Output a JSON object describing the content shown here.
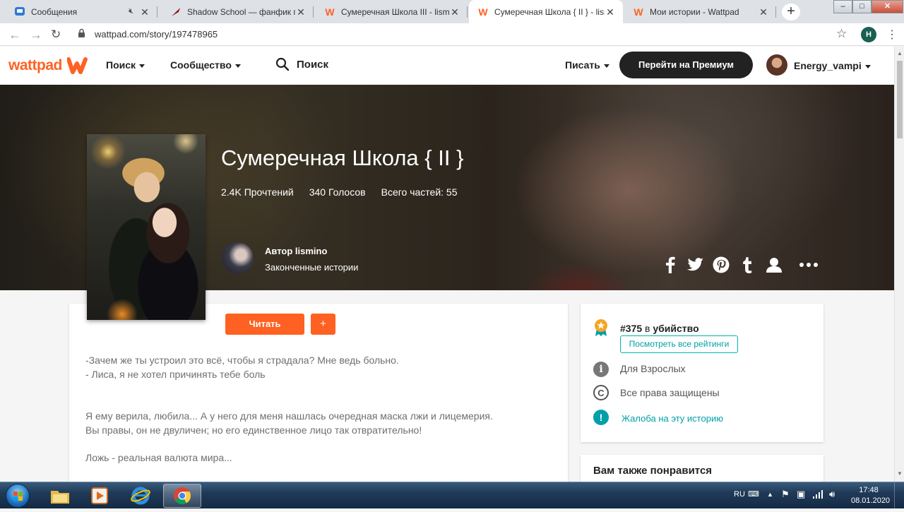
{
  "browser": {
    "tabs": [
      {
        "title": "Сообщения",
        "muted": true
      },
      {
        "title": "Shadow School — фанфик по ф"
      },
      {
        "title": "Сумеречная Школа III - lisminc"
      },
      {
        "title": "Сумеречная Школа { II } - lismi",
        "active": true
      },
      {
        "title": "Мои истории - Wattpad"
      }
    ],
    "url": "wattpad.com/story/197478965",
    "profile_initial": "H"
  },
  "header": {
    "logo": "wattpad",
    "nav_search": "Поиск",
    "nav_community": "Сообщество",
    "search_placeholder": "Поиск",
    "write": "Писать",
    "premium": "Перейти на Премиум",
    "username": "Energy_vampi"
  },
  "story": {
    "title": "Сумеречная Школа { II }",
    "reads": "2.4K Прочтений",
    "votes": "340 Голосов",
    "parts": "Всего частей: 55",
    "author": "Автор lismino",
    "status": "Законченные истории",
    "read_button": "Читать",
    "add_button": "+",
    "description": [
      "-Зачем же ты устроил это всё, чтобы я страдала? Мне ведь больно.",
      "- Лиса, я не хотел причинять тебе боль",
      "Я ему верила, любила... А у него для меня нашлась очередная маска лжи и лицемерия.",
      "Вы правы, он не двуличен; но его единственное лицо так отвратительно!",
      "Ложь - реальная валюта мира..."
    ]
  },
  "sidebar": {
    "rank_number": "#375",
    "rank_tag": "в убийство",
    "rankings_button": "Посмотреть все рейтинги",
    "mature": "Для Взрослых",
    "copyright": "Все права защищены",
    "report": "Жалоба на эту историю",
    "also_like": "Вам также понравится"
  },
  "taskbar": {
    "lang": "RU",
    "time": "17:48",
    "date": "08.01.2020"
  },
  "colors": {
    "accent": "#ff6122",
    "teal": "#00a0a8",
    "dark": "#222222"
  }
}
